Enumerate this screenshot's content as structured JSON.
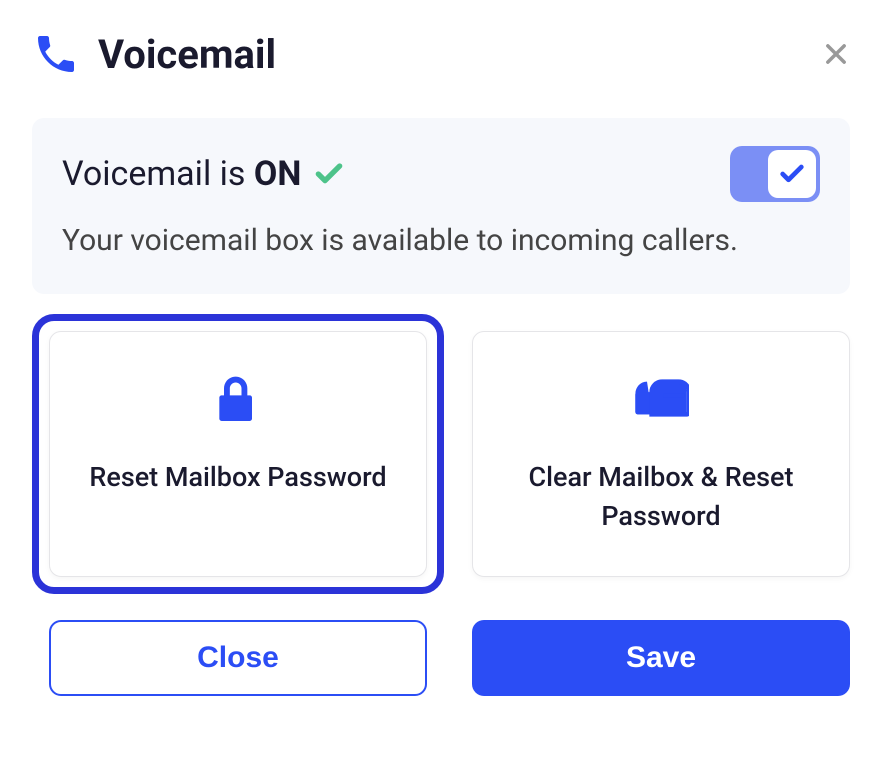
{
  "header": {
    "title": "Voicemail"
  },
  "status": {
    "label_prefix": "Voicemail is ",
    "label_state": "ON",
    "description": "Your voicemail box is available to incoming callers.",
    "toggle_on": true
  },
  "cards": {
    "reset_password": "Reset Mailbox Password",
    "clear_reset": "Clear Mailbox & Reset Password"
  },
  "buttons": {
    "close": "Close",
    "save": "Save"
  }
}
